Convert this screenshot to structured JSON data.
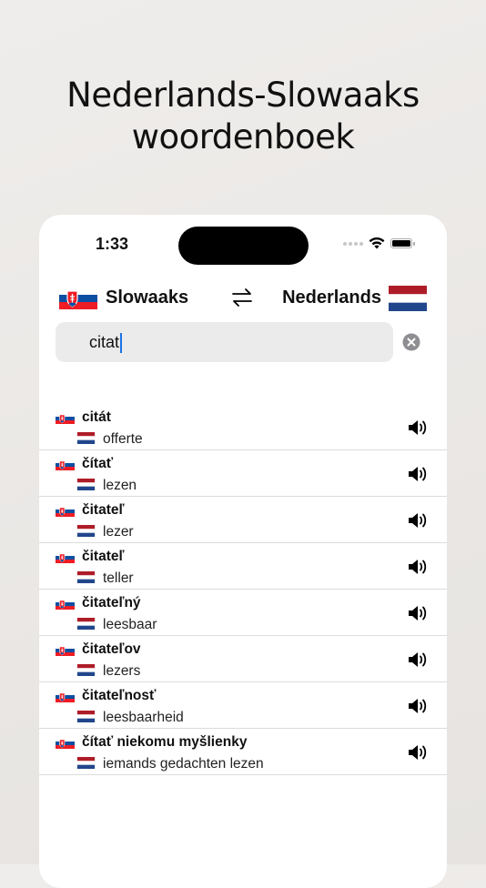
{
  "headline": {
    "line1": "Nederlands-Slowaaks",
    "line2": "woordenboek"
  },
  "status_bar": {
    "time": "1:33"
  },
  "language_bar": {
    "source_language": "Slowaaks",
    "target_language": "Nederlands",
    "source_flag": "slovakia-flag-icon",
    "target_flag": "netherlands-flag-icon",
    "swap_icon": "swap-arrows-icon"
  },
  "search": {
    "value": "citat",
    "clear_icon": "clear-circle-icon"
  },
  "results": [
    {
      "term": "citát",
      "translation": "offerte"
    },
    {
      "term": "čítať",
      "translation": "lezen"
    },
    {
      "term": "čitateľ",
      "translation": "lezer"
    },
    {
      "term": "čitateľ",
      "translation": "teller"
    },
    {
      "term": "čitateľný",
      "translation": "leesbaar"
    },
    {
      "term": "čitateľov",
      "translation": "lezers"
    },
    {
      "term": "čitateľnosť",
      "translation": "leesbaarheid"
    },
    {
      "term": "čítať niekomu myšlienky",
      "translation": "iemands gedachten lezen"
    }
  ],
  "colors": {
    "accent_caret": "#1a73e8",
    "search_bg": "#ebebeb",
    "divider": "#dcdcdc"
  }
}
